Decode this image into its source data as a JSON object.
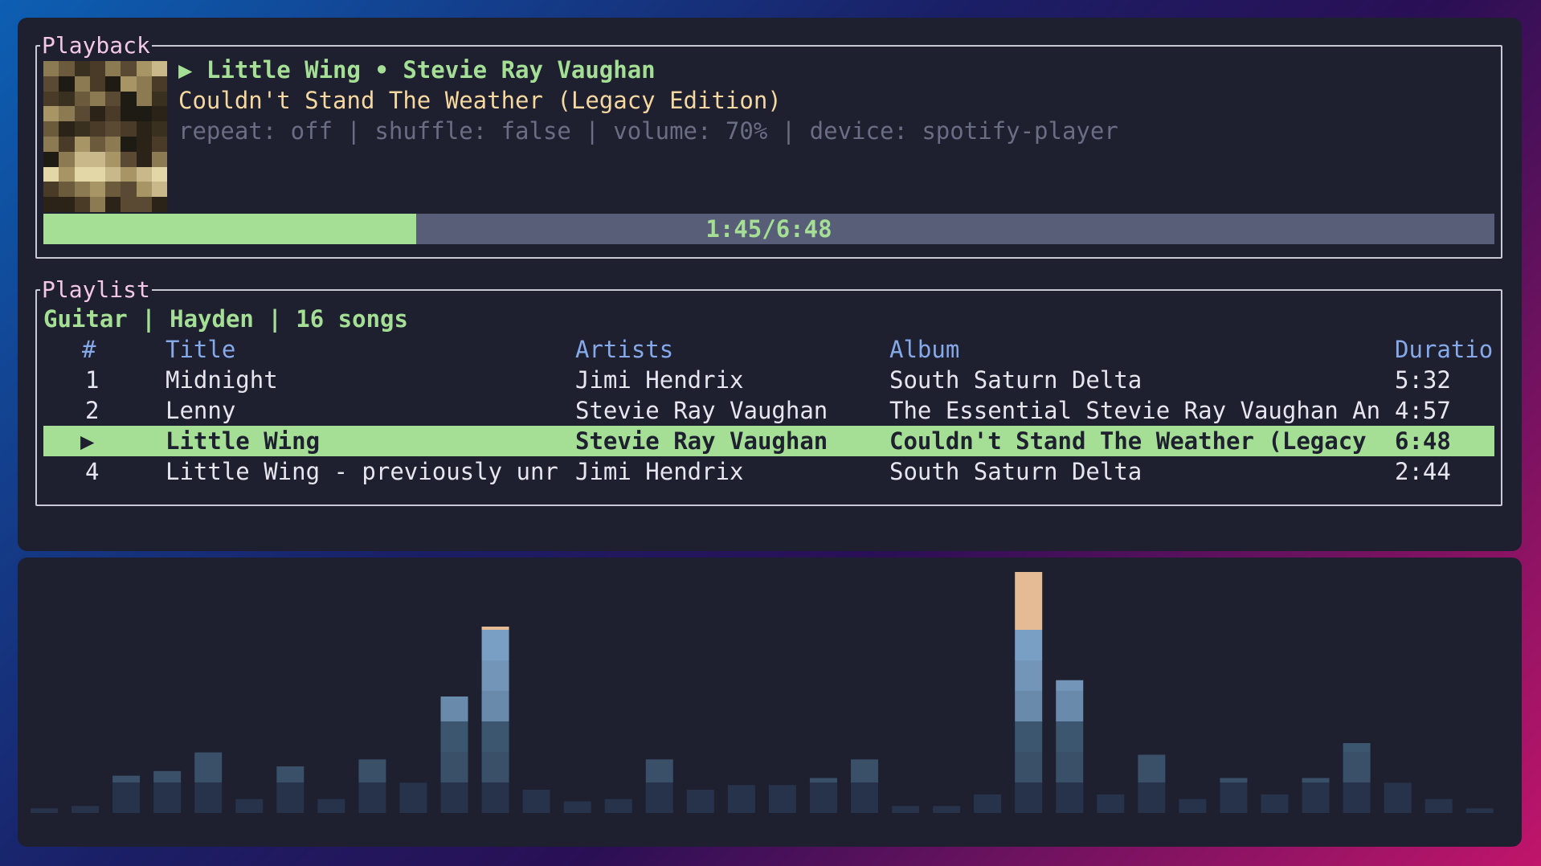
{
  "playback": {
    "panel_title": "Playback",
    "now_playing": "▶ Little Wing • Stevie Ray Vaughan",
    "album": "Couldn't Stand The Weather (Legacy Edition)",
    "status": "repeat: off | shuffle: false | volume: 70% | device: spotify-player",
    "progress_text": "1:45/6:48",
    "progress_fraction": 0.257
  },
  "playlist": {
    "panel_title": "Playlist",
    "summary": "Guitar | Hayden | 16 songs",
    "columns": {
      "num": "#",
      "title": "Title",
      "artists": "Artists",
      "album": "Album",
      "duration": "Duratio"
    },
    "rows": [
      {
        "num": "1",
        "title": "Midnight",
        "artists": "Jimi Hendrix",
        "album": "South Saturn Delta",
        "duration": "5:32"
      },
      {
        "num": "2",
        "title": "Lenny",
        "artists": "Stevie Ray Vaughan",
        "album": "The Essential Stevie Ray Vaughan An",
        "duration": "4:57"
      },
      {
        "num": "▶",
        "title": "Little Wing",
        "artists": "Stevie Ray Vaughan",
        "album": "Couldn't Stand The Weather (Legacy",
        "duration": "6:48"
      },
      {
        "num": "4",
        "title": "Little Wing - previously unr",
        "artists": "Jimi Hendrix",
        "album": "South Saturn Delta",
        "duration": "2:44"
      }
    ]
  },
  "visualizer": {
    "levels": [
      0.02,
      0.03,
      0.16,
      0.18,
      0.26,
      0.06,
      0.2,
      0.06,
      0.23,
      0.13,
      0.5,
      0.8,
      0.1,
      0.05,
      0.06,
      0.23,
      0.1,
      0.12,
      0.12,
      0.15,
      0.23,
      0.03,
      0.03,
      0.08,
      1.04,
      0.57,
      0.08,
      0.25,
      0.06,
      0.15,
      0.08,
      0.15,
      0.3,
      0.13,
      0.06,
      0.02
    ],
    "colors": {
      "low": "#2e4360",
      "mid": "#4a6d8c",
      "high": "#7fa7cc",
      "peak": "#f0c49c"
    }
  },
  "colors": {
    "accent_green": "#a4df95",
    "title_pink": "#f2c7e8",
    "header_blue": "#86a9ea",
    "album_gold": "#f5d7a0"
  }
}
